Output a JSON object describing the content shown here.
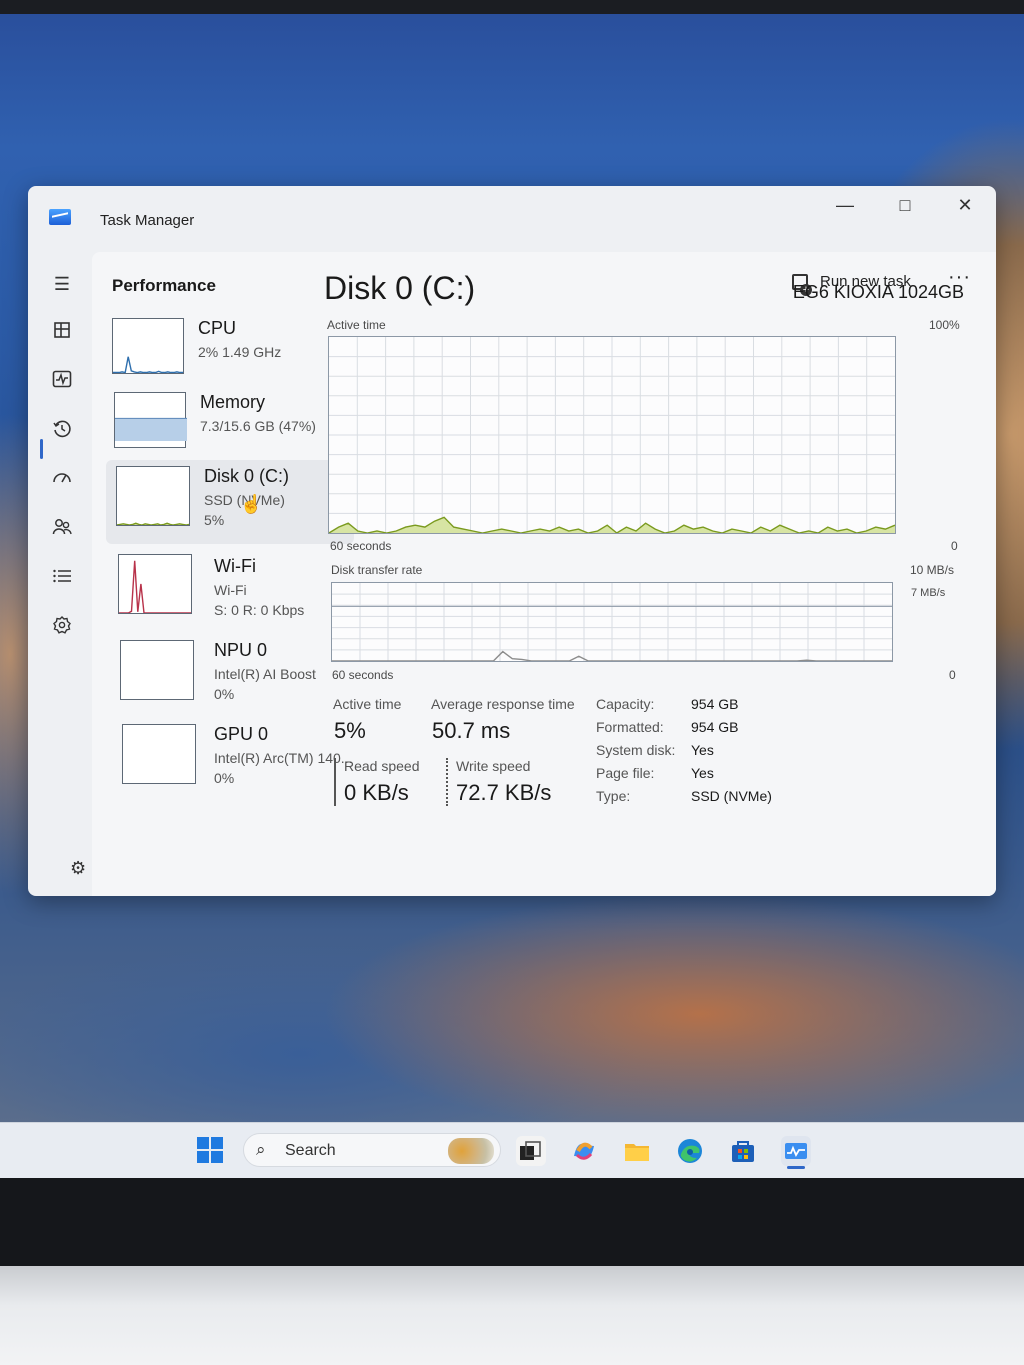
{
  "window": {
    "title": "Task Manager"
  },
  "header": {
    "page_title": "Performance",
    "run_new_task": "Run new task",
    "more": "···"
  },
  "taskbar": {
    "search_placeholder": "Search"
  },
  "resources": [
    {
      "name": "CPU",
      "line1": "2%  1.49 GHz",
      "line2": ""
    },
    {
      "name": "Memory",
      "line1": "7.3/15.6 GB (47%)",
      "line2": ""
    },
    {
      "name": "Disk 0 (C:)",
      "line1": "SSD (NVMe)",
      "line2": "5%"
    },
    {
      "name": "Wi-Fi",
      "line1": "Wi-Fi",
      "line2": "S: 0  R: 0 Kbps"
    },
    {
      "name": "NPU 0",
      "line1": "Intel(R) AI Boost",
      "line2": "0%"
    },
    {
      "name": "GPU 0",
      "line1": "Intel(R) Arc(TM) 140...",
      "line2": "0%"
    }
  ],
  "detail": {
    "title": "Disk 0 (C:)",
    "model": "EG6 KIOXIA 1024GB",
    "active_time_graph": {
      "label": "Active time",
      "max_label": "100%",
      "left_axis": "60 seconds",
      "right_axis": "0",
      "values": [
        0,
        3,
        5,
        1,
        0,
        1,
        0,
        1,
        3,
        4,
        3,
        6,
        8,
        3,
        2,
        1,
        0,
        1,
        2,
        1,
        0,
        1,
        2,
        1,
        3,
        1,
        2,
        0,
        1,
        4,
        0,
        3,
        1,
        5,
        2,
        0,
        1,
        4,
        2,
        3,
        1,
        0,
        2,
        1,
        0,
        3,
        1,
        4,
        2,
        0,
        1,
        0,
        3,
        1,
        2,
        0,
        1,
        3,
        2,
        4
      ]
    },
    "transfer_graph": {
      "label": "Disk transfer rate",
      "max_label": "10 MB/s",
      "inner_label": "7 MB/s",
      "left_axis": "60 seconds",
      "right_axis": "0",
      "values": [
        0,
        0,
        0,
        0,
        0,
        0,
        0,
        0,
        0,
        0,
        0,
        0,
        0,
        0,
        0,
        0,
        0,
        0,
        1.2,
        0.3,
        0.2,
        0,
        0,
        0,
        0,
        0,
        0.6,
        0,
        0,
        0,
        0,
        0,
        0,
        0,
        0,
        0,
        0,
        0,
        0,
        0,
        0,
        0,
        0,
        0,
        0,
        0,
        0,
        0,
        0,
        0,
        0.1,
        0,
        0,
        0,
        0,
        0,
        0,
        0,
        0,
        0
      ]
    },
    "stats": {
      "active_time_label": "Active time",
      "active_time": "5%",
      "response_label": "Average response time",
      "response": "50.7 ms",
      "read_label": "Read speed",
      "read": "0 KB/s",
      "write_label": "Write speed",
      "write": "72.7 KB/s"
    },
    "properties": [
      {
        "key": "Capacity:",
        "value": "954 GB"
      },
      {
        "key": "Formatted:",
        "value": "954 GB"
      },
      {
        "key": "System disk:",
        "value": "Yes"
      },
      {
        "key": "Page file:",
        "value": "Yes"
      },
      {
        "key": "Type:",
        "value": "SSD (NVMe)"
      }
    ]
  },
  "thumbnails": {
    "cpu": [
      1,
      1,
      1,
      2,
      1,
      30,
      4,
      2,
      1,
      2,
      1,
      1,
      2,
      1,
      1,
      3,
      1,
      1,
      2,
      1,
      1,
      2,
      1,
      1
    ],
    "memory_fraction": 0.47,
    "disk": [
      0,
      1,
      2,
      1,
      0,
      1,
      3,
      1,
      0,
      2,
      1,
      0,
      1,
      2,
      0,
      1,
      3,
      1,
      0,
      1,
      2,
      1,
      0,
      1
    ],
    "wifi": [
      0,
      0,
      0,
      0,
      3,
      90,
      2,
      50,
      0,
      0,
      0,
      0,
      0,
      0,
      0,
      0,
      0,
      0,
      0,
      0,
      0,
      0,
      0,
      0
    ]
  },
  "colors": {
    "accent": "#2f67c8",
    "cpu_line": "#2e6fae",
    "memory_fill": "#b7cfe8",
    "disk_line": "#7a9a1e",
    "disk_fill": "#d7e4a3",
    "wifi_line": "#b8324a",
    "grid": "#d9dde2"
  },
  "icons": {
    "app_logo": "task-manager-icon",
    "minimize": "—",
    "maximize": "□",
    "close": "✕",
    "hamburger": "☰",
    "settings": "⚙",
    "search": "⌕"
  }
}
